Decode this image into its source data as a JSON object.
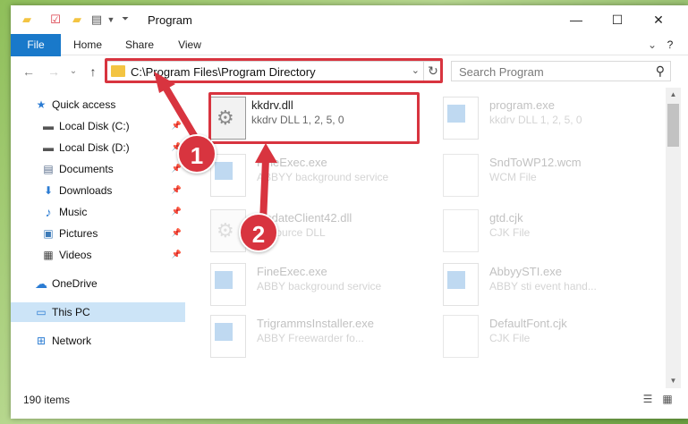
{
  "window": {
    "title": "Program",
    "min_glyph": "—",
    "max_glyph": "☐",
    "close_glyph": "✕"
  },
  "ribbon": {
    "tabs": [
      {
        "label": "File"
      },
      {
        "label": "Home"
      },
      {
        "label": "Share"
      },
      {
        "label": "View"
      }
    ],
    "expand_glyph": "⌄",
    "help_glyph": "?"
  },
  "nav": {
    "back_glyph": "←",
    "forward_glyph": "→",
    "recent_glyph": "⌄",
    "up_glyph": "↑",
    "address": "C:\\Program Files\\Program Directory",
    "address_drop_glyph": "⌄",
    "refresh_glyph": "↻",
    "search_placeholder": "Search Program",
    "search_glyph": "⚲"
  },
  "sidebar": {
    "items": [
      {
        "label": "Quick access",
        "icon": "star-icon",
        "glyph": "★",
        "color": "#2b7cd3",
        "pinned": false
      },
      {
        "label": "Local Disk (C:)",
        "icon": "drive-icon",
        "glyph": "▬",
        "color": "#555555",
        "pinned": true
      },
      {
        "label": "Local Disk (D:)",
        "icon": "drive-icon",
        "glyph": "▬",
        "color": "#555555",
        "pinned": true
      },
      {
        "label": "Documents",
        "icon": "documents-icon",
        "glyph": "▤",
        "color": "#5a6e8c",
        "pinned": true
      },
      {
        "label": "Downloads",
        "icon": "download-icon",
        "glyph": "⬇",
        "color": "#2b7cd3",
        "pinned": true
      },
      {
        "label": "Music",
        "icon": "music-icon",
        "glyph": "♪",
        "color": "#2b7cd3",
        "pinned": true
      },
      {
        "label": "Pictures",
        "icon": "pictures-icon",
        "glyph": "▣",
        "color": "#3d7bb8",
        "pinned": true
      },
      {
        "label": "Videos",
        "icon": "video-icon",
        "glyph": "▦",
        "color": "#444444",
        "pinned": true
      },
      {
        "label": "OneDrive",
        "icon": "cloud-icon",
        "glyph": "☁",
        "color": "#2b7cd3",
        "pinned": false
      },
      {
        "label": "This PC",
        "icon": "computer-icon",
        "glyph": "▭",
        "color": "#2b7cd3",
        "pinned": false,
        "selected": true
      },
      {
        "label": "Network",
        "icon": "network-icon",
        "glyph": "⊞",
        "color": "#2b7cd3",
        "pinned": false
      }
    ],
    "pin_glyph": "📌"
  },
  "files": [
    {
      "name": "kkdrv.dll",
      "desc": "kkdrv DLL 1, 2, 5, 0",
      "icon": "dll-icon",
      "faded": false
    },
    {
      "name": "program.exe",
      "desc": "kkdrv DLL 1, 2, 5, 0",
      "icon": "exe-icon",
      "faded": true
    },
    {
      "name": "FineExec.exe",
      "desc": "ABBYY background service",
      "icon": "exe-icon",
      "faded": true
    },
    {
      "name": "SndToWP12.wcm",
      "desc": "WCM File",
      "icon": "document-icon",
      "faded": true
    },
    {
      "name": "UpdateClient42.dll",
      "desc": "Resource DLL",
      "icon": "dll-icon",
      "faded": true
    },
    {
      "name": "gtd.cjk",
      "desc": "CJK File",
      "icon": "document-icon",
      "faded": true
    },
    {
      "name": "FineExec.exe",
      "desc": "ABBY background service",
      "icon": "exe-icon",
      "faded": true
    },
    {
      "name": "AbbyySTI.exe",
      "desc": "ABBY sti event hand...",
      "icon": "exe-icon",
      "faded": true
    },
    {
      "name": "TrigrammsInstaller.exe",
      "desc": "ABBY Freewarder fo...",
      "icon": "exe-icon",
      "faded": true
    },
    {
      "name": "DefaultFont.cjk",
      "desc": "CJK File",
      "icon": "document-icon",
      "faded": true
    }
  ],
  "status": {
    "item_count": "190 items",
    "details_glyph": "☰",
    "tiles_glyph": "▦"
  },
  "annotations": {
    "step1": "1",
    "step2": "2",
    "highlight_color": "#d8343f"
  }
}
